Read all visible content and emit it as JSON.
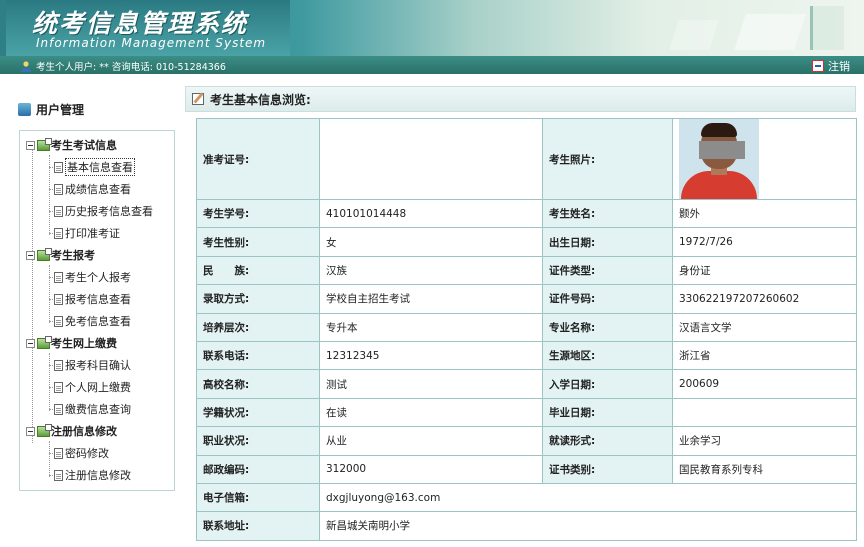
{
  "header": {
    "title_cn": "统考信息管理系统",
    "title_en": "Information Management System"
  },
  "infobar": {
    "user_text": "考生个人用户: ** 咨询电话: 010-51284366",
    "logout": "注销"
  },
  "sidebar": {
    "title": "用户管理",
    "groups": [
      {
        "label": "考生考试信息",
        "items": [
          "基本信息查看",
          "成绩信息查看",
          "历史报考信息查看",
          "打印准考证"
        ]
      },
      {
        "label": "考生报考",
        "items": [
          "考生个人报考",
          "报考信息查看",
          "免考信息查看"
        ]
      },
      {
        "label": "考生网上缴费",
        "items": [
          "报考科目确认",
          "个人网上缴费",
          "缴费信息查询"
        ]
      },
      {
        "label": "注册信息修改",
        "items": [
          "密码修改",
          "注册信息修改"
        ]
      }
    ],
    "active_item": "基本信息查看"
  },
  "panel": {
    "title": "考生基本信息浏览:"
  },
  "info": {
    "admission_label": "准考证号:",
    "admission_value": "",
    "photo_label": "考生照片:",
    "rows": [
      {
        "k1": "考生学号:",
        "v1": "410101014448",
        "k2": "考生姓名:",
        "v2": "颢外"
      },
      {
        "k1": "考生性别:",
        "v1": "女",
        "k2": "出生日期:",
        "v2": "1972/7/26"
      },
      {
        "k1": "民　　族:",
        "v1": "汉族",
        "k2": "证件类型:",
        "v2": "身份证"
      },
      {
        "k1": "录取方式:",
        "v1": "学校自主招生考试",
        "k2": "证件号码:",
        "v2": "330622197207260602"
      },
      {
        "k1": "培养层次:",
        "v1": "专升本",
        "k2": "专业名称:",
        "v2": "汉语言文学"
      },
      {
        "k1": "联系电话:",
        "v1": "12312345",
        "k2": "生源地区:",
        "v2": "浙江省"
      },
      {
        "k1": "高校名称:",
        "v1": "测试",
        "k2": "入学日期:",
        "v2": "200609"
      },
      {
        "k1": "学籍状况:",
        "v1": "在读",
        "k2": "毕业日期:",
        "v2": ""
      },
      {
        "k1": "职业状况:",
        "v1": "从业",
        "k2": "就读形式:",
        "v2": "业余学习"
      },
      {
        "k1": "邮政编码:",
        "v1": "312000",
        "k2": "证书类别:",
        "v2": "国民教育系列专科"
      }
    ],
    "email_label": "电子信箱:",
    "email_value": "dxgjluyong@163.com",
    "address_label": "联系地址:",
    "address_value": "新昌城关南明小学"
  }
}
